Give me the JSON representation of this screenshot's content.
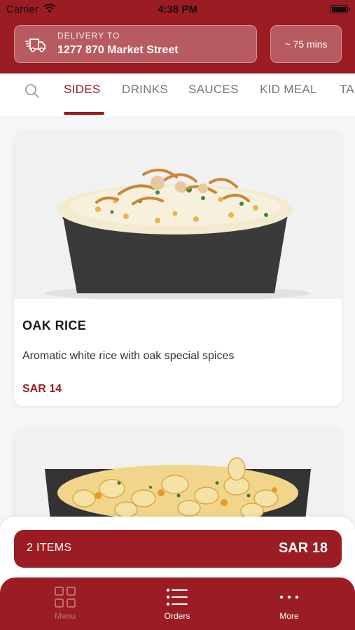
{
  "status_bar": {
    "carrier": "Carrier",
    "time": "4:38 PM"
  },
  "header": {
    "delivery_label": "DELIVERY TO",
    "delivery_address": "1277 870 Market Street",
    "eta": "~ 75 mins",
    "icons": {
      "delivery": "truck-icon"
    }
  },
  "tabs": {
    "items": [
      {
        "label": "SIDES",
        "active": true
      },
      {
        "label": "DRINKS",
        "active": false
      },
      {
        "label": "SAUCES",
        "active": false
      },
      {
        "label": "KID MEAL",
        "active": false
      },
      {
        "label": "TA",
        "active": false
      }
    ]
  },
  "products": [
    {
      "name": "OAK RICE",
      "description": "Aromatic white rice with oak special spices",
      "price": "SAR 14"
    },
    {
      "name": "",
      "description": "",
      "price": ""
    }
  ],
  "cart": {
    "count_label": "2 ITEMS",
    "total": "SAR 18"
  },
  "bottom_nav": {
    "items": [
      {
        "label": "Menu",
        "icon": "grid-icon"
      },
      {
        "label": "Orders",
        "icon": "list-icon"
      },
      {
        "label": "More",
        "icon": "more-dots-icon"
      }
    ]
  },
  "colors": {
    "brand": "#9b1c23",
    "tab_inactive": "#777777",
    "background": "#f6f6f6"
  }
}
